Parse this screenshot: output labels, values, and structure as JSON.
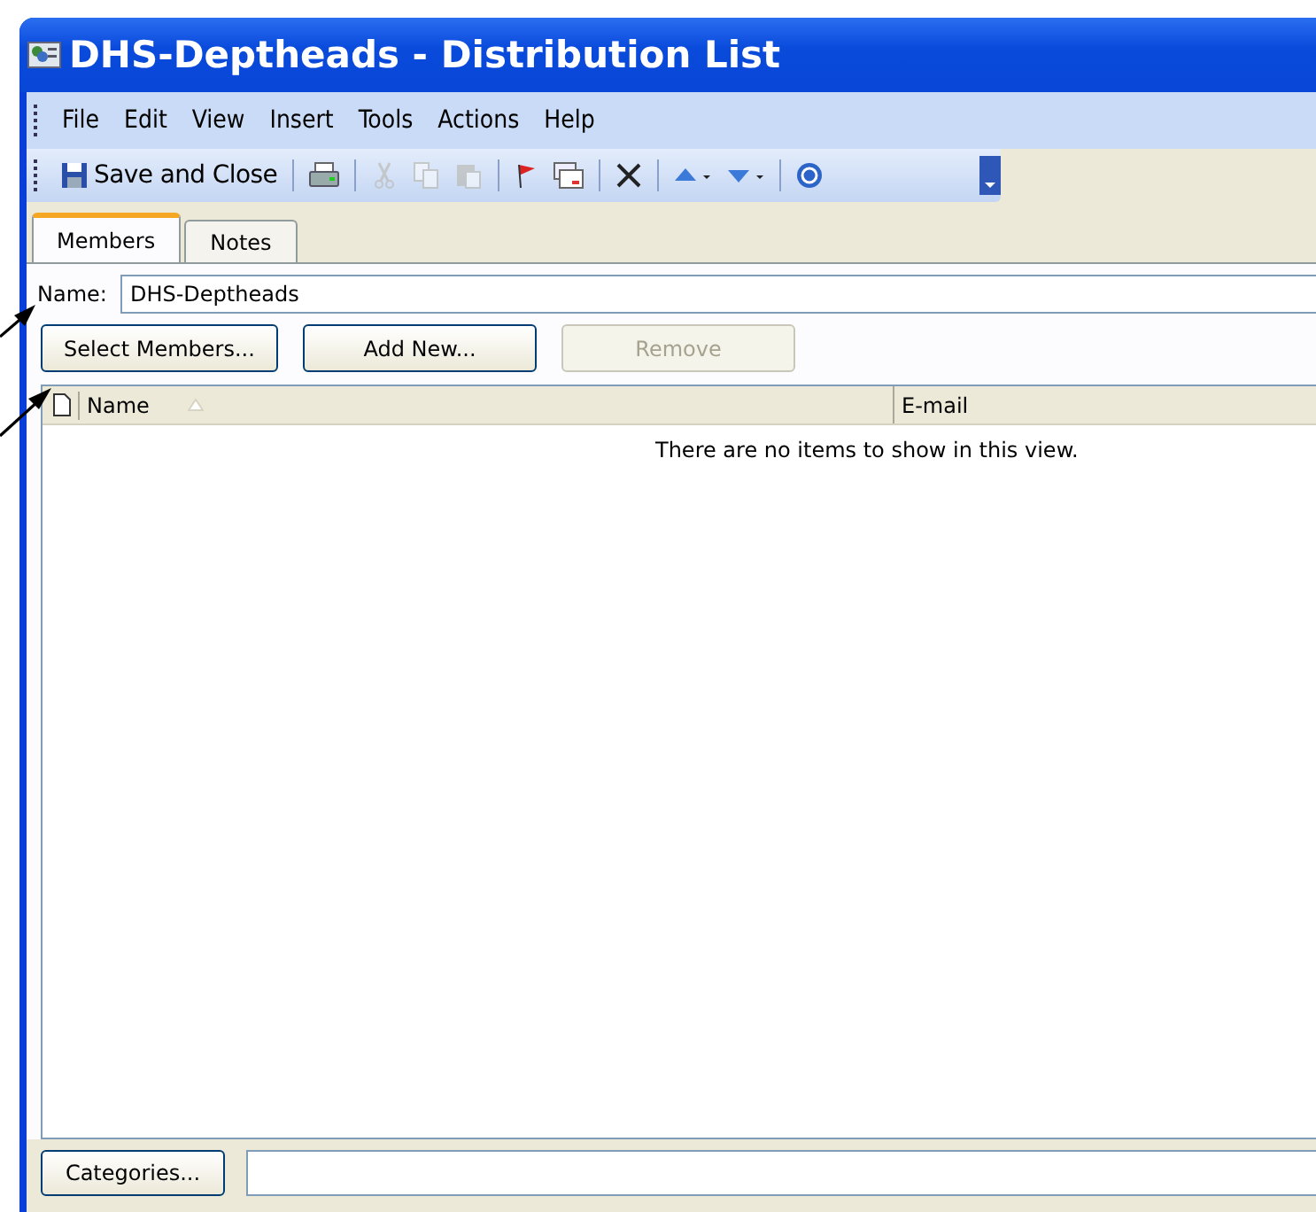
{
  "window": {
    "title": "DHS-Deptheads - Distribution List"
  },
  "menu": [
    "File",
    "Edit",
    "View",
    "Insert",
    "Tools",
    "Actions",
    "Help"
  ],
  "toolbar": [
    {
      "kind": "save",
      "label": "Save and Close"
    },
    {
      "kind": "sep"
    },
    {
      "kind": "print",
      "disabled": false
    },
    {
      "kind": "sep"
    },
    {
      "kind": "cut",
      "disabled": true
    },
    {
      "kind": "copy",
      "disabled": true
    },
    {
      "kind": "paste",
      "disabled": true
    },
    {
      "kind": "sep"
    },
    {
      "kind": "flag",
      "disabled": false
    },
    {
      "kind": "card",
      "disabled": false
    },
    {
      "kind": "sep"
    },
    {
      "kind": "delete",
      "disabled": false
    },
    {
      "kind": "sep"
    },
    {
      "kind": "up",
      "disabled": false
    },
    {
      "kind": "down",
      "disabled": false
    },
    {
      "kind": "sep"
    },
    {
      "kind": "help",
      "disabled": false
    }
  ],
  "tabs": [
    {
      "label": "Members",
      "selected": true
    },
    {
      "label": "Notes",
      "selected": false
    }
  ],
  "name_field": {
    "label": "Name:",
    "value": "DHS-Deptheads"
  },
  "buttons": [
    {
      "label": "Select Members...",
      "disabled": false
    },
    {
      "label": "Add New...",
      "disabled": false
    },
    {
      "label": "Remove",
      "disabled": true
    }
  ],
  "table": {
    "columns": [
      "Name",
      "E-mail"
    ],
    "empty_message": "There are no items to show in this view."
  },
  "categories": {
    "button": "Categories..."
  }
}
